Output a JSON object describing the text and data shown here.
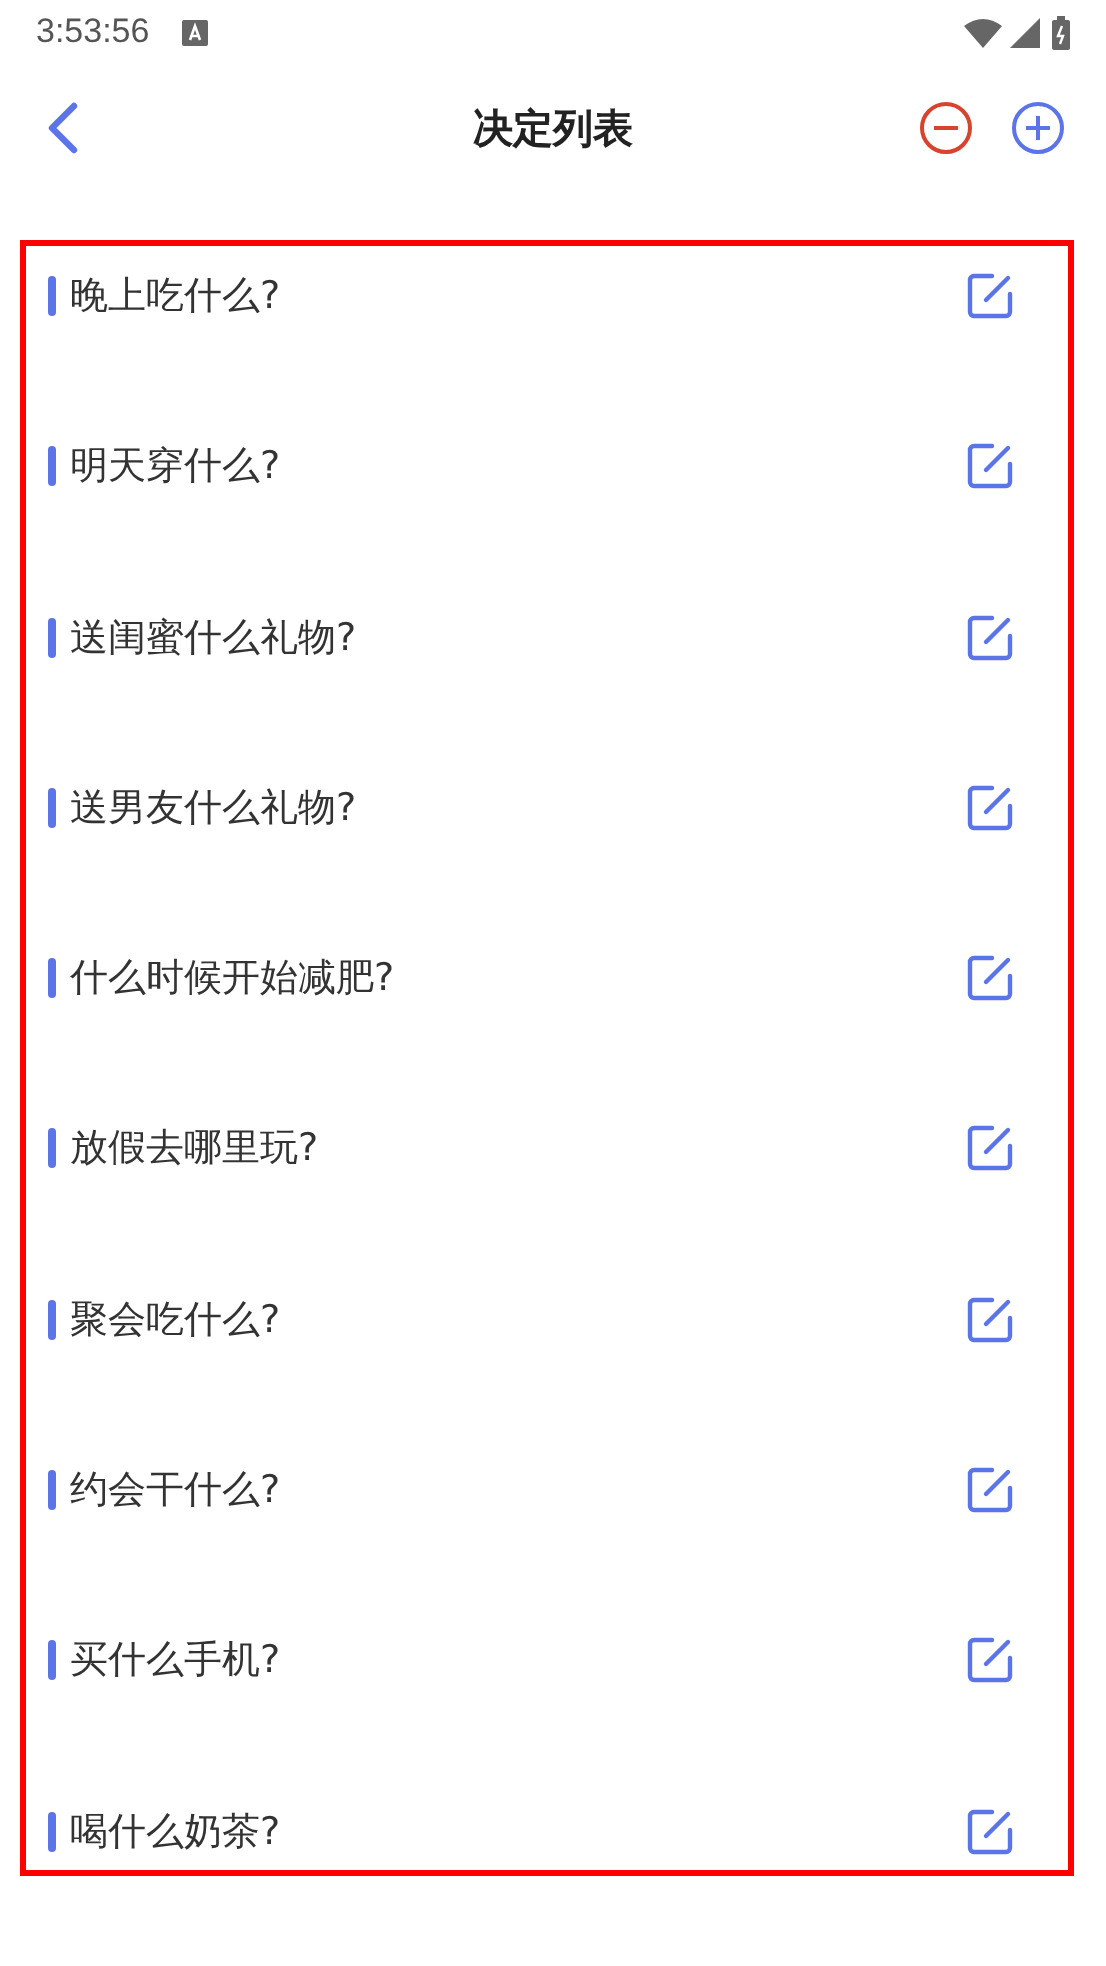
{
  "status_bar": {
    "time": "3:53:56"
  },
  "app_bar": {
    "title": "决定列表"
  },
  "decisions": [
    {
      "title": "晚上吃什么?"
    },
    {
      "title": "明天穿什么?"
    },
    {
      "title": "送闺蜜什么礼物?"
    },
    {
      "title": "送男友什么礼物?"
    },
    {
      "title": "什么时候开始减肥?"
    },
    {
      "title": "放假去哪里玩?"
    },
    {
      "title": "聚会吃什么?"
    },
    {
      "title": "约会干什么?"
    },
    {
      "title": "买什么手机?"
    },
    {
      "title": "喝什么奶茶?"
    }
  ]
}
